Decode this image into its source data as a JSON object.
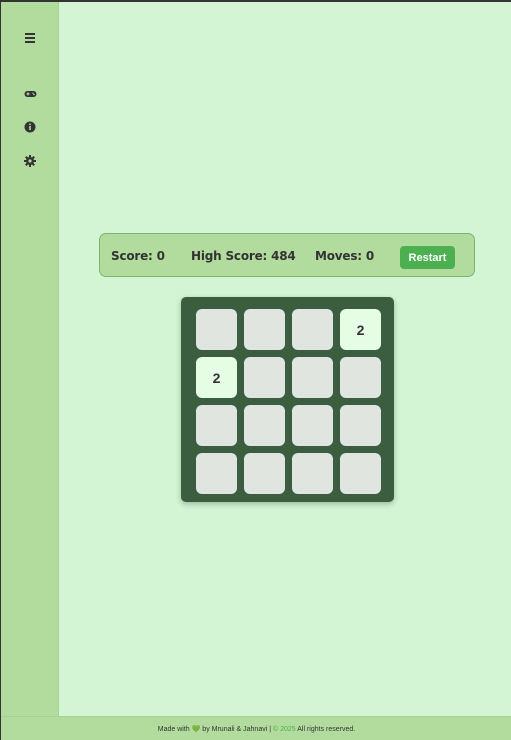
{
  "sidebar": {
    "menu_icon": "hamburger-menu-icon",
    "items": [
      {
        "icon": "gamepad-icon",
        "glyph": "🎮"
      },
      {
        "icon": "info-icon",
        "glyph": "ℹ"
      },
      {
        "icon": "gear-icon",
        "glyph": "⚙"
      }
    ]
  },
  "scorebar": {
    "score_text": "Score: 0",
    "high_score_text": "High Score: 484",
    "moves_text": "Moves: 0",
    "restart_label": "Restart"
  },
  "board": {
    "size": 4,
    "tiles": [
      [
        "",
        "",
        "",
        "2"
      ],
      [
        "2",
        "",
        "",
        ""
      ],
      [
        "",
        "",
        "",
        ""
      ],
      [
        "",
        "",
        "",
        ""
      ]
    ]
  },
  "footer": {
    "made_with": "Made with",
    "heart_glyph": "💚",
    "by": "by Mrunali & Jahnavi |",
    "year": "© 2025",
    "rights": "All rights reserved."
  },
  "colors": {
    "background": "#d3f5d3",
    "sidebar": "#b2dc9d",
    "board": "#3b5e40",
    "empty_tile": "#e1e5df",
    "tile_2": "#e5fce5",
    "restart_button": "#4caf50"
  }
}
